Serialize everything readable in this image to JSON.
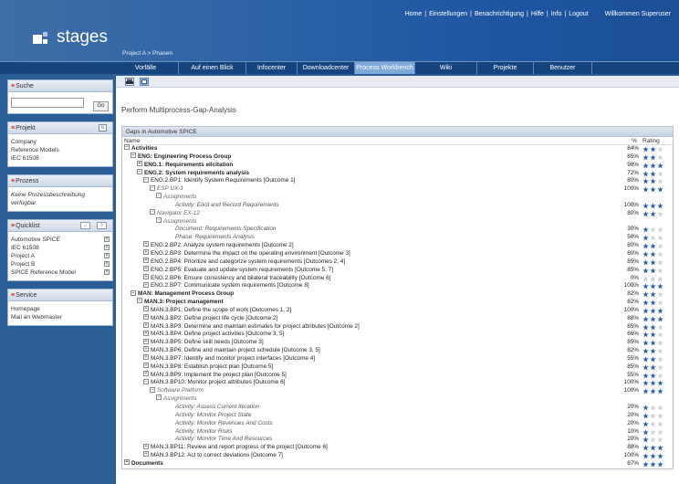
{
  "header": {
    "links": [
      "Home",
      "Einstellungen",
      "Benachrichtigung",
      "Hilfe",
      "Info",
      "Logout"
    ],
    "welcome": "Willkommen Superuser",
    "logo_text": "stages",
    "breadcrumb": "Project A  >  Phasen"
  },
  "nav": {
    "tabs": [
      "Vorfälle",
      "Auf einen Blick",
      "Infocenter",
      "Downloadcenter",
      "Process Workbench",
      "Wiki",
      "Projekte",
      "Benutzer"
    ],
    "active": "Process Workbench"
  },
  "sidebar": {
    "search": {
      "title": "Suche",
      "go": "Go",
      "value": ""
    },
    "project": {
      "title": "Projekt",
      "lines": [
        "Company",
        "Reference Models",
        "IEC 61508"
      ]
    },
    "process": {
      "title": "Prozess",
      "text": "Keine Prozessbeschreibung verfügbar."
    },
    "quicklist": {
      "title": "Quicklist",
      "items": [
        "Automotive SPICE",
        "IEC 61508",
        "Project A",
        "Project B",
        "SPICE Reference Model"
      ]
    },
    "service": {
      "title": "Service",
      "items": [
        "Homepage",
        "Mail an Webmaster"
      ]
    }
  },
  "main": {
    "title": "Perform Multiprocess-Gap-Analysis",
    "table_title": "Gaps in Automotive SPICE",
    "col_name": "Name",
    "col_pct": "%",
    "col_rating": "Rating",
    "rows": [
      {
        "t": "Activities",
        "p": "84%",
        "r": 2,
        "l": 0,
        "s": "b",
        "tg": "−"
      },
      {
        "t": "ENG: Engineering Process Group",
        "p": "85%",
        "r": 2,
        "l": 1,
        "s": "b",
        "tg": "−"
      },
      {
        "t": "ENG.1: Requirements elicitation",
        "p": "98%",
        "r": 3,
        "l": 2,
        "s": "b",
        "tg": "+"
      },
      {
        "t": "ENG.2: System requirements analysis",
        "p": "72%",
        "r": 2,
        "l": 2,
        "s": "b",
        "tg": "−"
      },
      {
        "t": "ENG.2.BP1: Identify System Requirements [Outcome 1]",
        "p": "80%",
        "r": 2,
        "l": 3,
        "s": "",
        "tg": "−"
      },
      {
        "t": "ESP UX-1",
        "p": "100%",
        "r": 3,
        "l": 4,
        "s": "it",
        "tg": "−"
      },
      {
        "t": "Assignments",
        "p": "",
        "r": 0,
        "l": 5,
        "s": "it",
        "tg": "−"
      },
      {
        "t": "Activity: Elicit and Record Requirements",
        "p": "100%",
        "r": 3,
        "l": 6,
        "s": "ac",
        "tg": ""
      },
      {
        "t": "Navigator EX-12",
        "p": "80%",
        "r": 2,
        "l": 4,
        "s": "it",
        "tg": "−"
      },
      {
        "t": "Assignments",
        "p": "",
        "r": 0,
        "l": 5,
        "s": "it",
        "tg": "−"
      },
      {
        "t": "Document: Requirements Specification",
        "p": "30%",
        "r": 1,
        "l": 6,
        "s": "ac",
        "tg": ""
      },
      {
        "t": "Phase: Requirements Analysis",
        "p": "50%",
        "r": 1,
        "l": 6,
        "s": "ac",
        "tg": ""
      },
      {
        "t": "ENG.2.BP2: Analyze system requirements [Outcome 2]",
        "p": "80%",
        "r": 2,
        "l": 3,
        "s": "",
        "tg": "+"
      },
      {
        "t": "ENG.2.BP3: Determine the impact on the operating environment [Outcome 3]",
        "p": "60%",
        "r": 2,
        "l": 3,
        "s": "",
        "tg": "+"
      },
      {
        "t": "ENG.2.BP4: Prioritize and categorize system requirements [Outcomes 2, 4]",
        "p": "85%",
        "r": 2,
        "l": 3,
        "s": "",
        "tg": "+"
      },
      {
        "t": "ENG.2.BP5: Evaluate and update system requirements [Outcome 5, 7]",
        "p": "85%",
        "r": 2,
        "l": 3,
        "s": "",
        "tg": "+"
      },
      {
        "t": "ENG.2.BP6: Ensure consistency and bilateral traceability [Outcome 6]",
        "p": "0%",
        "r": 0,
        "l": 3,
        "s": "",
        "tg": "+"
      },
      {
        "t": "ENG.2.BP7: Communicate system requirements [Outcome 8]",
        "p": "100%",
        "r": 3,
        "l": 3,
        "s": "",
        "tg": "+"
      },
      {
        "t": "MAN: Management Process Group",
        "p": "82%",
        "r": 2,
        "l": 1,
        "s": "b",
        "tg": "−"
      },
      {
        "t": "MAN.3: Project management",
        "p": "82%",
        "r": 2,
        "l": 2,
        "s": "b",
        "tg": "−"
      },
      {
        "t": "MAN.3.BP1: Define the scope of work [Outcomes 1, 2]",
        "p": "100%",
        "r": 3,
        "l": 3,
        "s": "",
        "tg": "+"
      },
      {
        "t": "MAN.3.BP2: Define project life cycle [Outcome 2]",
        "p": "88%",
        "r": 3,
        "l": 3,
        "s": "",
        "tg": "+"
      },
      {
        "t": "MAN.3.BP3: Determine and maintain estimates for project attributes [Outcome 2]",
        "p": "85%",
        "r": 2,
        "l": 3,
        "s": "",
        "tg": "+"
      },
      {
        "t": "MAN.3.BP4: Define project activities [Outcome 3, 5]",
        "p": "66%",
        "r": 2,
        "l": 3,
        "s": "",
        "tg": "+"
      },
      {
        "t": "MAN.3.BP5: Define skill needs [Outcome 3]",
        "p": "85%",
        "r": 2,
        "l": 3,
        "s": "",
        "tg": "+"
      },
      {
        "t": "MAN.3.BP6: Define and maintain project schedule [Outcome 3, 5]",
        "p": "82%",
        "r": 2,
        "l": 3,
        "s": "",
        "tg": "+"
      },
      {
        "t": "MAN.3.BP7: Identify and monitor project interfaces [Outcome 4]",
        "p": "55%",
        "r": 2,
        "l": 3,
        "s": "",
        "tg": "+"
      },
      {
        "t": "MAN.3.BP8: Establish project plan [Outcome 5]",
        "p": "85%",
        "r": 2,
        "l": 3,
        "s": "",
        "tg": "+"
      },
      {
        "t": "MAN.3.BP9: Implement the project plan [Outcome 5]",
        "p": "55%",
        "r": 2,
        "l": 3,
        "s": "",
        "tg": "+"
      },
      {
        "t": "MAN.3.BP10: Monitor project attributes [Outcome 6]",
        "p": "100%",
        "r": 3,
        "l": 3,
        "s": "",
        "tg": "−"
      },
      {
        "t": "Software Platform",
        "p": "100%",
        "r": 3,
        "l": 4,
        "s": "it",
        "tg": "−"
      },
      {
        "t": "Assignments",
        "p": "",
        "r": 0,
        "l": 5,
        "s": "it",
        "tg": "−"
      },
      {
        "t": "Activity: Assess Current Iteration",
        "p": "20%",
        "r": 1,
        "l": 6,
        "s": "ac",
        "tg": ""
      },
      {
        "t": "Activity: Monitor Project State",
        "p": "20%",
        "r": 1,
        "l": 6,
        "s": "ac",
        "tg": ""
      },
      {
        "t": "Activity: Monitor Revenues And Costs",
        "p": "20%",
        "r": 1,
        "l": 6,
        "s": "ac",
        "tg": ""
      },
      {
        "t": "Activity: Monitor Risks",
        "p": "10%",
        "r": 1,
        "l": 6,
        "s": "ac",
        "tg": ""
      },
      {
        "t": "Activity: Monitor Time And Resources",
        "p": "20%",
        "r": 1,
        "l": 6,
        "s": "ac",
        "tg": ""
      },
      {
        "t": "MAN.3.BP11: Review and report progress of the project [Outcome 6]",
        "p": "88%",
        "r": 3,
        "l": 3,
        "s": "",
        "tg": "+"
      },
      {
        "t": "MAN.3.BP12: Act to correct deviations [Outcome 7]",
        "p": "100%",
        "r": 3,
        "l": 3,
        "s": "",
        "tg": "+"
      },
      {
        "t": "Documents",
        "p": "87%",
        "r": 3,
        "l": 0,
        "s": "b",
        "tg": "+"
      }
    ]
  },
  "colors": {
    "star_filled": "#2f62a8",
    "star_empty": "#c9d3df"
  }
}
